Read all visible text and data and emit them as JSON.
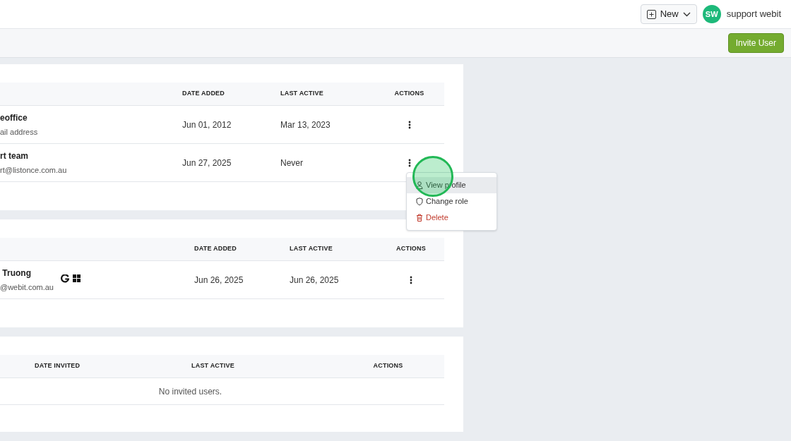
{
  "topbar": {
    "new_button": "New",
    "avatar": "SW",
    "user_name": "support webit"
  },
  "toolbar": {
    "invite_button": "Invite User"
  },
  "tables": [
    {
      "kind": "members",
      "columns": [
        "DATE ADDED",
        "LAST ACTIVE",
        "ACTIONS"
      ],
      "rows": [
        {
          "name": "eoffice",
          "email": "ail address",
          "date_added": "Jun 01, 2012",
          "last_active": "Mar 13, 2023"
        },
        {
          "name": "rt team",
          "email": "rt@listonce.com.au",
          "date_added": "Jun 27, 2025",
          "last_active": "Never",
          "menu": {
            "items": [
              {
                "label": "View profile",
                "kind": "profile",
                "hovered": true
              },
              {
                "label": "Change role",
                "kind": "role",
                "hovered": false
              },
              {
                "label": "Delete",
                "kind": "delete",
                "hovered": false
              }
            ]
          }
        }
      ]
    },
    {
      "kind": "members",
      "columns": [
        "DATE ADDED",
        "LAST ACTIVE",
        "ACTIONS"
      ],
      "rows": [
        {
          "name": " Truong",
          "email": "@webit.com.au",
          "date_added": "Jun 26, 2025",
          "last_active": "Jun 26, 2025",
          "google_sign_in": true,
          "microsoft_sign_in": true
        }
      ]
    },
    {
      "kind": "invites",
      "columns": [
        "DATE INVITED",
        "LAST ACTIVE",
        "ACTIONS"
      ],
      "empty_message": "No invited users."
    }
  ]
}
